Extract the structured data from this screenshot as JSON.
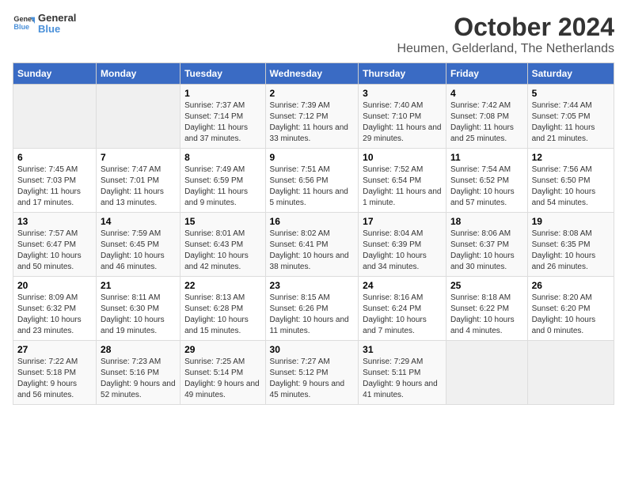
{
  "header": {
    "logo_line1": "General",
    "logo_line2": "Blue",
    "title": "October 2024",
    "subtitle": "Heumen, Gelderland, The Netherlands"
  },
  "days_of_week": [
    "Sunday",
    "Monday",
    "Tuesday",
    "Wednesday",
    "Thursday",
    "Friday",
    "Saturday"
  ],
  "weeks": [
    [
      {
        "day": "",
        "info": ""
      },
      {
        "day": "",
        "info": ""
      },
      {
        "day": "1",
        "info": "Sunrise: 7:37 AM\nSunset: 7:14 PM\nDaylight: 11 hours and 37 minutes."
      },
      {
        "day": "2",
        "info": "Sunrise: 7:39 AM\nSunset: 7:12 PM\nDaylight: 11 hours and 33 minutes."
      },
      {
        "day": "3",
        "info": "Sunrise: 7:40 AM\nSunset: 7:10 PM\nDaylight: 11 hours and 29 minutes."
      },
      {
        "day": "4",
        "info": "Sunrise: 7:42 AM\nSunset: 7:08 PM\nDaylight: 11 hours and 25 minutes."
      },
      {
        "day": "5",
        "info": "Sunrise: 7:44 AM\nSunset: 7:05 PM\nDaylight: 11 hours and 21 minutes."
      }
    ],
    [
      {
        "day": "6",
        "info": "Sunrise: 7:45 AM\nSunset: 7:03 PM\nDaylight: 11 hours and 17 minutes."
      },
      {
        "day": "7",
        "info": "Sunrise: 7:47 AM\nSunset: 7:01 PM\nDaylight: 11 hours and 13 minutes."
      },
      {
        "day": "8",
        "info": "Sunrise: 7:49 AM\nSunset: 6:59 PM\nDaylight: 11 hours and 9 minutes."
      },
      {
        "day": "9",
        "info": "Sunrise: 7:51 AM\nSunset: 6:56 PM\nDaylight: 11 hours and 5 minutes."
      },
      {
        "day": "10",
        "info": "Sunrise: 7:52 AM\nSunset: 6:54 PM\nDaylight: 11 hours and 1 minute."
      },
      {
        "day": "11",
        "info": "Sunrise: 7:54 AM\nSunset: 6:52 PM\nDaylight: 10 hours and 57 minutes."
      },
      {
        "day": "12",
        "info": "Sunrise: 7:56 AM\nSunset: 6:50 PM\nDaylight: 10 hours and 54 minutes."
      }
    ],
    [
      {
        "day": "13",
        "info": "Sunrise: 7:57 AM\nSunset: 6:47 PM\nDaylight: 10 hours and 50 minutes."
      },
      {
        "day": "14",
        "info": "Sunrise: 7:59 AM\nSunset: 6:45 PM\nDaylight: 10 hours and 46 minutes."
      },
      {
        "day": "15",
        "info": "Sunrise: 8:01 AM\nSunset: 6:43 PM\nDaylight: 10 hours and 42 minutes."
      },
      {
        "day": "16",
        "info": "Sunrise: 8:02 AM\nSunset: 6:41 PM\nDaylight: 10 hours and 38 minutes."
      },
      {
        "day": "17",
        "info": "Sunrise: 8:04 AM\nSunset: 6:39 PM\nDaylight: 10 hours and 34 minutes."
      },
      {
        "day": "18",
        "info": "Sunrise: 8:06 AM\nSunset: 6:37 PM\nDaylight: 10 hours and 30 minutes."
      },
      {
        "day": "19",
        "info": "Sunrise: 8:08 AM\nSunset: 6:35 PM\nDaylight: 10 hours and 26 minutes."
      }
    ],
    [
      {
        "day": "20",
        "info": "Sunrise: 8:09 AM\nSunset: 6:32 PM\nDaylight: 10 hours and 23 minutes."
      },
      {
        "day": "21",
        "info": "Sunrise: 8:11 AM\nSunset: 6:30 PM\nDaylight: 10 hours and 19 minutes."
      },
      {
        "day": "22",
        "info": "Sunrise: 8:13 AM\nSunset: 6:28 PM\nDaylight: 10 hours and 15 minutes."
      },
      {
        "day": "23",
        "info": "Sunrise: 8:15 AM\nSunset: 6:26 PM\nDaylight: 10 hours and 11 minutes."
      },
      {
        "day": "24",
        "info": "Sunrise: 8:16 AM\nSunset: 6:24 PM\nDaylight: 10 hours and 7 minutes."
      },
      {
        "day": "25",
        "info": "Sunrise: 8:18 AM\nSunset: 6:22 PM\nDaylight: 10 hours and 4 minutes."
      },
      {
        "day": "26",
        "info": "Sunrise: 8:20 AM\nSunset: 6:20 PM\nDaylight: 10 hours and 0 minutes."
      }
    ],
    [
      {
        "day": "27",
        "info": "Sunrise: 7:22 AM\nSunset: 5:18 PM\nDaylight: 9 hours and 56 minutes."
      },
      {
        "day": "28",
        "info": "Sunrise: 7:23 AM\nSunset: 5:16 PM\nDaylight: 9 hours and 52 minutes."
      },
      {
        "day": "29",
        "info": "Sunrise: 7:25 AM\nSunset: 5:14 PM\nDaylight: 9 hours and 49 minutes."
      },
      {
        "day": "30",
        "info": "Sunrise: 7:27 AM\nSunset: 5:12 PM\nDaylight: 9 hours and 45 minutes."
      },
      {
        "day": "31",
        "info": "Sunrise: 7:29 AM\nSunset: 5:11 PM\nDaylight: 9 hours and 41 minutes."
      },
      {
        "day": "",
        "info": ""
      },
      {
        "day": "",
        "info": ""
      }
    ]
  ]
}
